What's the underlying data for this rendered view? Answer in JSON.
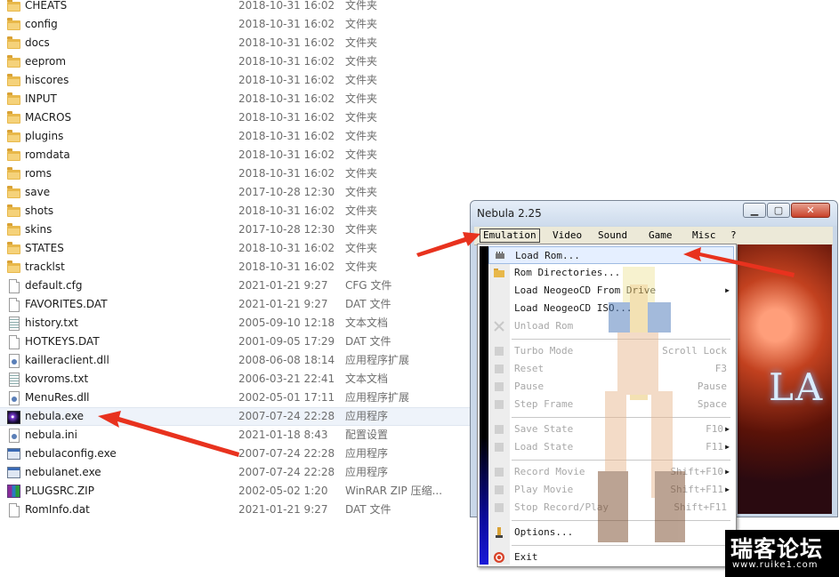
{
  "files": [
    {
      "name": "CHEATS",
      "date": "2018-10-31 16:02",
      "type": "文件夹",
      "icon": "folder-icon"
    },
    {
      "name": "config",
      "date": "2018-10-31 16:02",
      "type": "文件夹",
      "icon": "folder-icon"
    },
    {
      "name": "docs",
      "date": "2018-10-31 16:02",
      "type": "文件夹",
      "icon": "folder-icon"
    },
    {
      "name": "eeprom",
      "date": "2018-10-31 16:02",
      "type": "文件夹",
      "icon": "folder-icon"
    },
    {
      "name": "hiscores",
      "date": "2018-10-31 16:02",
      "type": "文件夹",
      "icon": "folder-icon"
    },
    {
      "name": "INPUT",
      "date": "2018-10-31 16:02",
      "type": "文件夹",
      "icon": "folder-icon"
    },
    {
      "name": "MACROS",
      "date": "2018-10-31 16:02",
      "type": "文件夹",
      "icon": "folder-icon"
    },
    {
      "name": "plugins",
      "date": "2018-10-31 16:02",
      "type": "文件夹",
      "icon": "folder-icon"
    },
    {
      "name": "romdata",
      "date": "2018-10-31 16:02",
      "type": "文件夹",
      "icon": "folder-icon"
    },
    {
      "name": "roms",
      "date": "2018-10-31 16:02",
      "type": "文件夹",
      "icon": "folder-icon"
    },
    {
      "name": "save",
      "date": "2017-10-28 12:30",
      "type": "文件夹",
      "icon": "folder-icon"
    },
    {
      "name": "shots",
      "date": "2018-10-31 16:02",
      "type": "文件夹",
      "icon": "folder-icon"
    },
    {
      "name": "skins",
      "date": "2017-10-28 12:30",
      "type": "文件夹",
      "icon": "folder-icon"
    },
    {
      "name": "STATES",
      "date": "2018-10-31 16:02",
      "type": "文件夹",
      "icon": "folder-icon"
    },
    {
      "name": "tracklst",
      "date": "2018-10-31 16:02",
      "type": "文件夹",
      "icon": "folder-icon"
    },
    {
      "name": "default.cfg",
      "date": "2021-01-21 9:27",
      "type": "CFG 文件",
      "icon": "file-icon"
    },
    {
      "name": "FAVORITES.DAT",
      "date": "2021-01-21 9:27",
      "type": "DAT 文件",
      "icon": "file-icon"
    },
    {
      "name": "history.txt",
      "date": "2005-09-10 12:18",
      "type": "文本文档",
      "icon": "text-file-icon"
    },
    {
      "name": "HOTKEYS.DAT",
      "date": "2001-09-05 17:29",
      "type": "DAT 文件",
      "icon": "file-icon"
    },
    {
      "name": "kailleraclient.dll",
      "date": "2008-06-08 18:14",
      "type": "应用程序扩展",
      "icon": "dll-icon"
    },
    {
      "name": "kovroms.txt",
      "date": "2006-03-21 22:41",
      "type": "文本文档",
      "icon": "text-file-icon"
    },
    {
      "name": "MenuRes.dll",
      "date": "2002-05-01 17:11",
      "type": "应用程序扩展",
      "icon": "dll-icon"
    },
    {
      "name": "nebula.exe",
      "date": "2007-07-24 22:28",
      "type": "应用程序",
      "icon": "nebula-exe-icon",
      "selected": true
    },
    {
      "name": "nebula.ini",
      "date": "2021-01-18 8:43",
      "type": "配置设置",
      "icon": "ini-file-icon"
    },
    {
      "name": "nebulaconfig.exe",
      "date": "2007-07-24 22:28",
      "type": "应用程序",
      "icon": "exe-icon"
    },
    {
      "name": "nebulanet.exe",
      "date": "2007-07-24 22:28",
      "type": "应用程序",
      "icon": "exe-icon"
    },
    {
      "name": "PLUGSRC.ZIP",
      "date": "2002-05-02 1:20",
      "type": "WinRAR ZIP 压缩...",
      "icon": "winrar-zip-icon"
    },
    {
      "name": "RomInfo.dat",
      "date": "2021-01-21 9:27",
      "type": "DAT 文件",
      "icon": "file-icon"
    }
  ],
  "window": {
    "title": "Nebula 2.25",
    "controls": {
      "minimize": "minimize-icon",
      "maximize": "maximize-icon",
      "close": "close-icon"
    }
  },
  "menu": [
    "Emulation",
    "Video",
    "Sound",
    "Game",
    "Misc",
    "?"
  ],
  "dropdown": [
    {
      "label": "Load Rom...",
      "shortcut": "",
      "icon": "chip-icon",
      "state": "highlighted"
    },
    {
      "label": "Rom Directories...",
      "shortcut": "",
      "icon": "folder-icon",
      "state": "enabled"
    },
    {
      "label": "Load NeogeoCD From Drive",
      "shortcut": "",
      "icon": "",
      "state": "enabled",
      "submenu": true
    },
    {
      "label": "Load NeogeoCD ISO...",
      "shortcut": "",
      "icon": "",
      "state": "enabled"
    },
    {
      "label": "Unload Rom",
      "shortcut": "",
      "icon": "x-icon",
      "state": "disabled",
      "sep_after": true
    },
    {
      "label": "Turbo Mode",
      "shortcut": "Scroll Lock",
      "icon": "turbo-icon",
      "state": "disabled"
    },
    {
      "label": "Reset",
      "shortcut": "F3",
      "icon": "reset-icon",
      "state": "disabled"
    },
    {
      "label": "Pause",
      "shortcut": "Pause",
      "icon": "pause-icon",
      "state": "disabled"
    },
    {
      "label": "Step Frame",
      "shortcut": "Space",
      "icon": "step-icon",
      "state": "disabled",
      "sep_after": true
    },
    {
      "label": "Save State",
      "shortcut": "F10",
      "icon": "save-state-icon",
      "state": "disabled",
      "submenu": true
    },
    {
      "label": "Load State",
      "shortcut": "F11",
      "icon": "load-state-icon",
      "state": "disabled",
      "submenu": true,
      "sep_after": true
    },
    {
      "label": "Record Movie",
      "shortcut": "Shift+F10",
      "icon": "record-icon",
      "state": "disabled",
      "submenu": true
    },
    {
      "label": "Play Movie",
      "shortcut": "Shift+F11",
      "icon": "play-icon",
      "state": "disabled",
      "submenu": true
    },
    {
      "label": "Stop Record/Play",
      "shortcut": "Shift+F11",
      "icon": "stop-icon",
      "state": "disabled",
      "sep_after": true
    },
    {
      "label": "Options...",
      "shortcut": "",
      "icon": "options-icon",
      "state": "enabled",
      "sep_after": true
    },
    {
      "label": "Exit",
      "shortcut": "",
      "icon": "exit-icon",
      "state": "enabled"
    }
  ],
  "game_logo": "LA",
  "watermark": {
    "main": "瑞客论坛",
    "url": "www.ruike1.com"
  },
  "colors": {
    "arrow": "#e8321e",
    "menu_bg": "#ece9d8",
    "highlight": "#e5efff",
    "side_bar": "#0a0a9a"
  }
}
